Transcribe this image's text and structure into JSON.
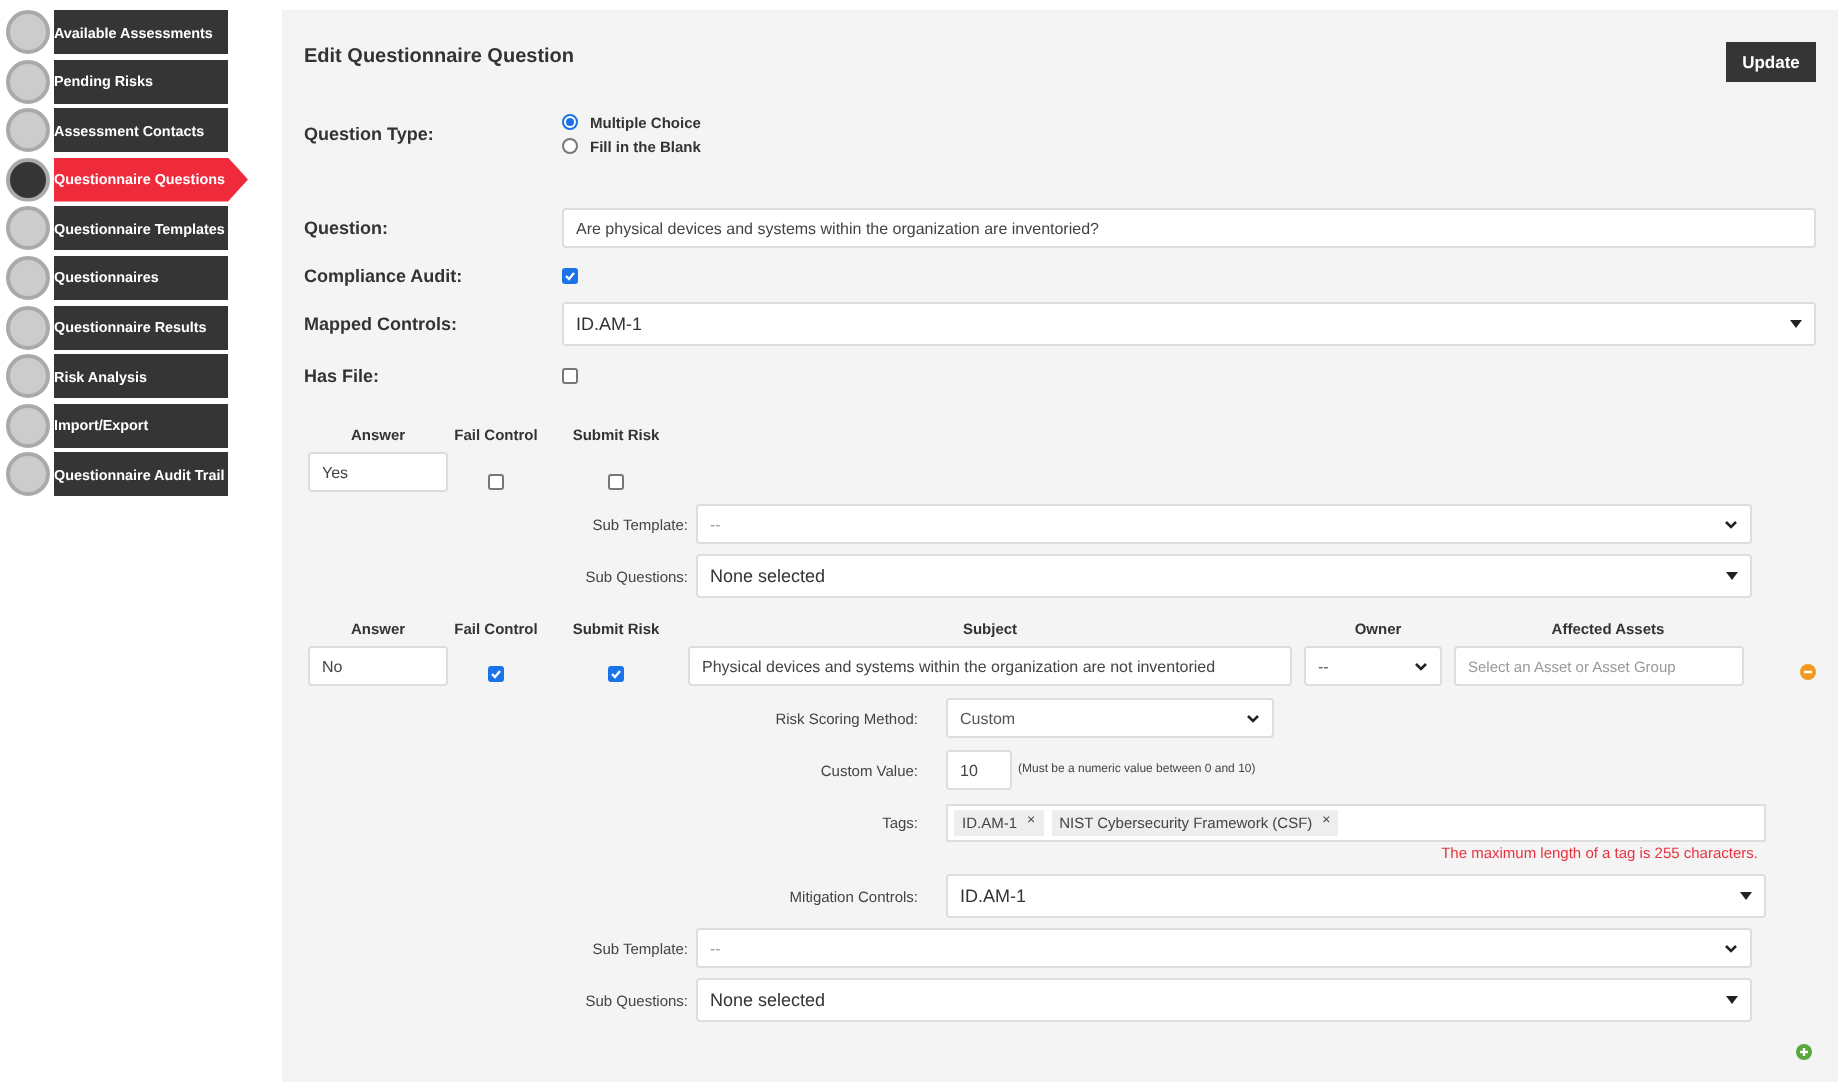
{
  "sidebar": {
    "items": [
      {
        "label": "Available Assessments",
        "selected": false
      },
      {
        "label": "Pending Risks",
        "selected": false
      },
      {
        "label": "Assessment Contacts",
        "selected": false
      },
      {
        "label": "Questionnaire Questions",
        "selected": true
      },
      {
        "label": "Questionnaire Templates",
        "selected": false
      },
      {
        "label": "Questionnaires",
        "selected": false
      },
      {
        "label": "Questionnaire Results",
        "selected": false
      },
      {
        "label": "Risk Analysis",
        "selected": false
      },
      {
        "label": "Import/Export",
        "selected": false
      },
      {
        "label": "Questionnaire Audit Trail",
        "selected": false
      }
    ]
  },
  "form": {
    "title": "Edit Questionnaire Question",
    "update_button": "Update",
    "question_type": {
      "label": "Question Type:",
      "options": [
        {
          "label": "Multiple Choice",
          "selected": true
        },
        {
          "label": "Fill in the Blank",
          "selected": false
        }
      ]
    },
    "question": {
      "label": "Question:",
      "value": "Are physical devices and systems within the organization are inventoried?"
    },
    "compliance_audit": {
      "label": "Compliance Audit:",
      "checked": true
    },
    "mapped_controls": {
      "label": "Mapped Controls:",
      "value": "ID.AM-1"
    },
    "has_file": {
      "label": "Has File:",
      "checked": false
    }
  },
  "answers": [
    {
      "answer_label": "Answer",
      "fail_label": "Fail Control",
      "submit_label": "Submit Risk",
      "value": "Yes",
      "fail_control": false,
      "submit_risk": false,
      "removable": false,
      "sub_template_label": "Sub Template:",
      "sub_template": "--",
      "sub_questions_label": "Sub Questions:",
      "sub_questions": "None selected"
    },
    {
      "answer_label": "Answer",
      "fail_label": "Fail Control",
      "submit_label": "Submit Risk",
      "value": "No",
      "fail_control": true,
      "submit_risk": true,
      "removable": true,
      "risk": {
        "subject_label": "Subject",
        "owner_label": "Owner",
        "assets_label": "Affected Assets",
        "subject": "Physical devices and systems within the organization are not inventoried",
        "owner": "--",
        "assets_placeholder": "Select an Asset or Asset Group",
        "scoring_label": "Risk Scoring Method:",
        "scoring": "Custom",
        "custom_label": "Custom Value:",
        "custom_value": "10",
        "custom_hint": "(Must be a numeric value between 0 and 10)",
        "tags_label": "Tags:",
        "tags": [
          "ID.AM-1",
          "NIST Cybersecurity Framework (CSF)"
        ],
        "tag_remove": "×",
        "tag_error": "The maximum length of a tag is 255 characters.",
        "mitigation_label": "Mitigation Controls:",
        "mitigation": "ID.AM-1"
      },
      "sub_template_label": "Sub Template:",
      "sub_template": "--",
      "sub_questions_label": "Sub Questions:",
      "sub_questions": "None selected"
    }
  ]
}
